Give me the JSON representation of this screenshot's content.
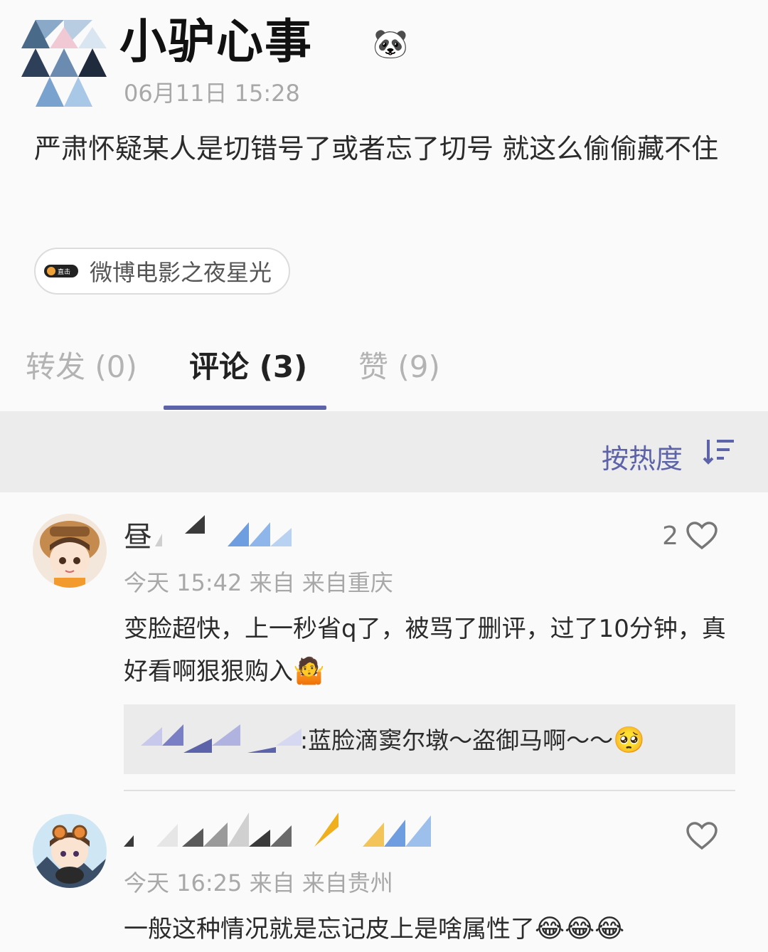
{
  "post": {
    "author": "小驴心事",
    "author_emoji": "🐼",
    "time": "06月11日 15:28",
    "text": "严肃怀疑某人是切错号了或者忘了切号 就这么偷偷藏不住",
    "topic": {
      "badge": "直击",
      "label": "微博电影之夜星光"
    }
  },
  "tabs": [
    {
      "label": "转发 (0)"
    },
    {
      "label": "评论 (3)"
    },
    {
      "label": "赞 (9)"
    }
  ],
  "sort": {
    "label": "按热度"
  },
  "comments": [
    {
      "name_visible": "昼",
      "likes": "2",
      "time": "今天 15:42 来自 来自重庆",
      "text": "变脸超快，上一秒省q了，被骂了删评，过了10分钟，真好看啊狠狠购入",
      "text_emoji": "🤷",
      "reply": {
        "text": ":蓝脸滴窦尔墩～盗御马啊～～",
        "emoji": "🥺"
      }
    },
    {
      "likes": "",
      "time": "今天 16:25 来自 来自贵州",
      "text": "一般这种情况就是忘记皮上是啥属性了",
      "text_emoji": "😂😂😂"
    }
  ],
  "colors": {
    "accent": "#5d63a8",
    "muted": "#a8a8a8",
    "sort_bg": "#ececec"
  }
}
